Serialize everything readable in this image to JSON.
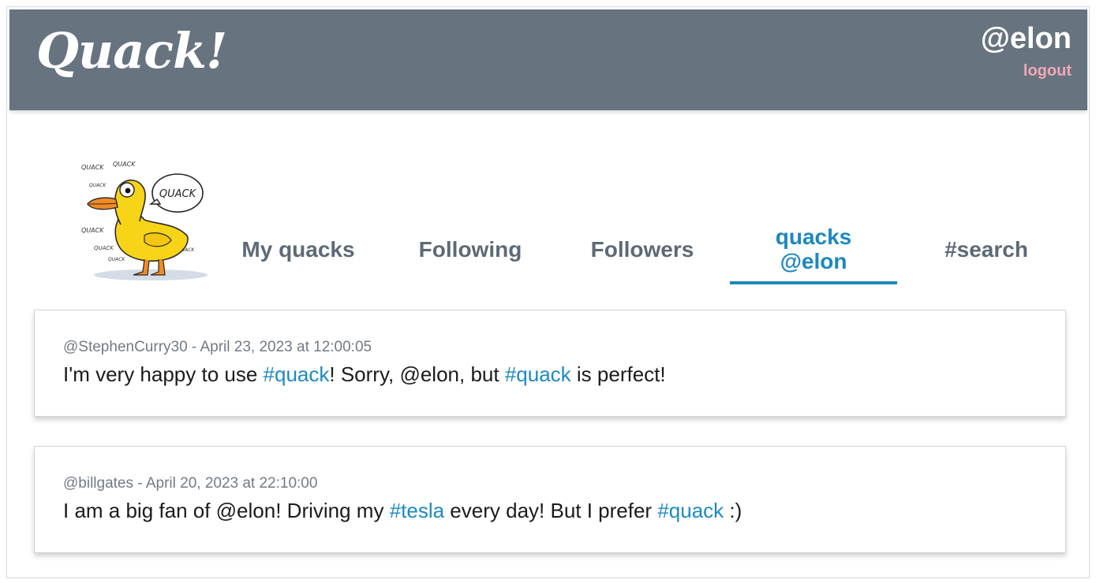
{
  "header": {
    "brand": "Quack!",
    "user_handle": "@elon",
    "logout_label": "logout"
  },
  "tabs": [
    {
      "label": "My quacks",
      "active": false
    },
    {
      "label": "Following",
      "active": false
    },
    {
      "label": "Followers",
      "active": false
    },
    {
      "label_line1": "quacks",
      "label_line2": "@elon",
      "active": true
    },
    {
      "label": "#search",
      "active": false
    }
  ],
  "avatar": {
    "icon": "duck-cartoon-icon",
    "speech_bubble": "QUACK",
    "background_words": [
      "QUACK",
      "QUACK",
      "QUACK",
      "QUACK",
      "QUACK",
      "QUACK",
      "QUACK"
    ]
  },
  "quacks": [
    {
      "meta": "@StephenCurry30 - April 23, 2023 at 12:00:05",
      "segments": [
        {
          "text": "I'm very happy to use ",
          "tag": false
        },
        {
          "text": "#quack",
          "tag": true
        },
        {
          "text": "! Sorry, @elon, but ",
          "tag": false
        },
        {
          "text": "#quack",
          "tag": true
        },
        {
          "text": " is perfect!",
          "tag": false
        }
      ]
    },
    {
      "meta": "@billgates - April 20, 2023 at 22:10:00",
      "segments": [
        {
          "text": "I am a big fan of @elon! Driving my ",
          "tag": false
        },
        {
          "text": "#tesla",
          "tag": true
        },
        {
          "text": " every day! But I prefer ",
          "tag": false
        },
        {
          "text": "#quack",
          "tag": true
        },
        {
          "text": " :)",
          "tag": false
        }
      ]
    }
  ],
  "colors": {
    "header_bg": "#67747f",
    "accent": "#1c88bf",
    "logout": "#f2a7b6",
    "tab_text": "#5d6a75"
  }
}
